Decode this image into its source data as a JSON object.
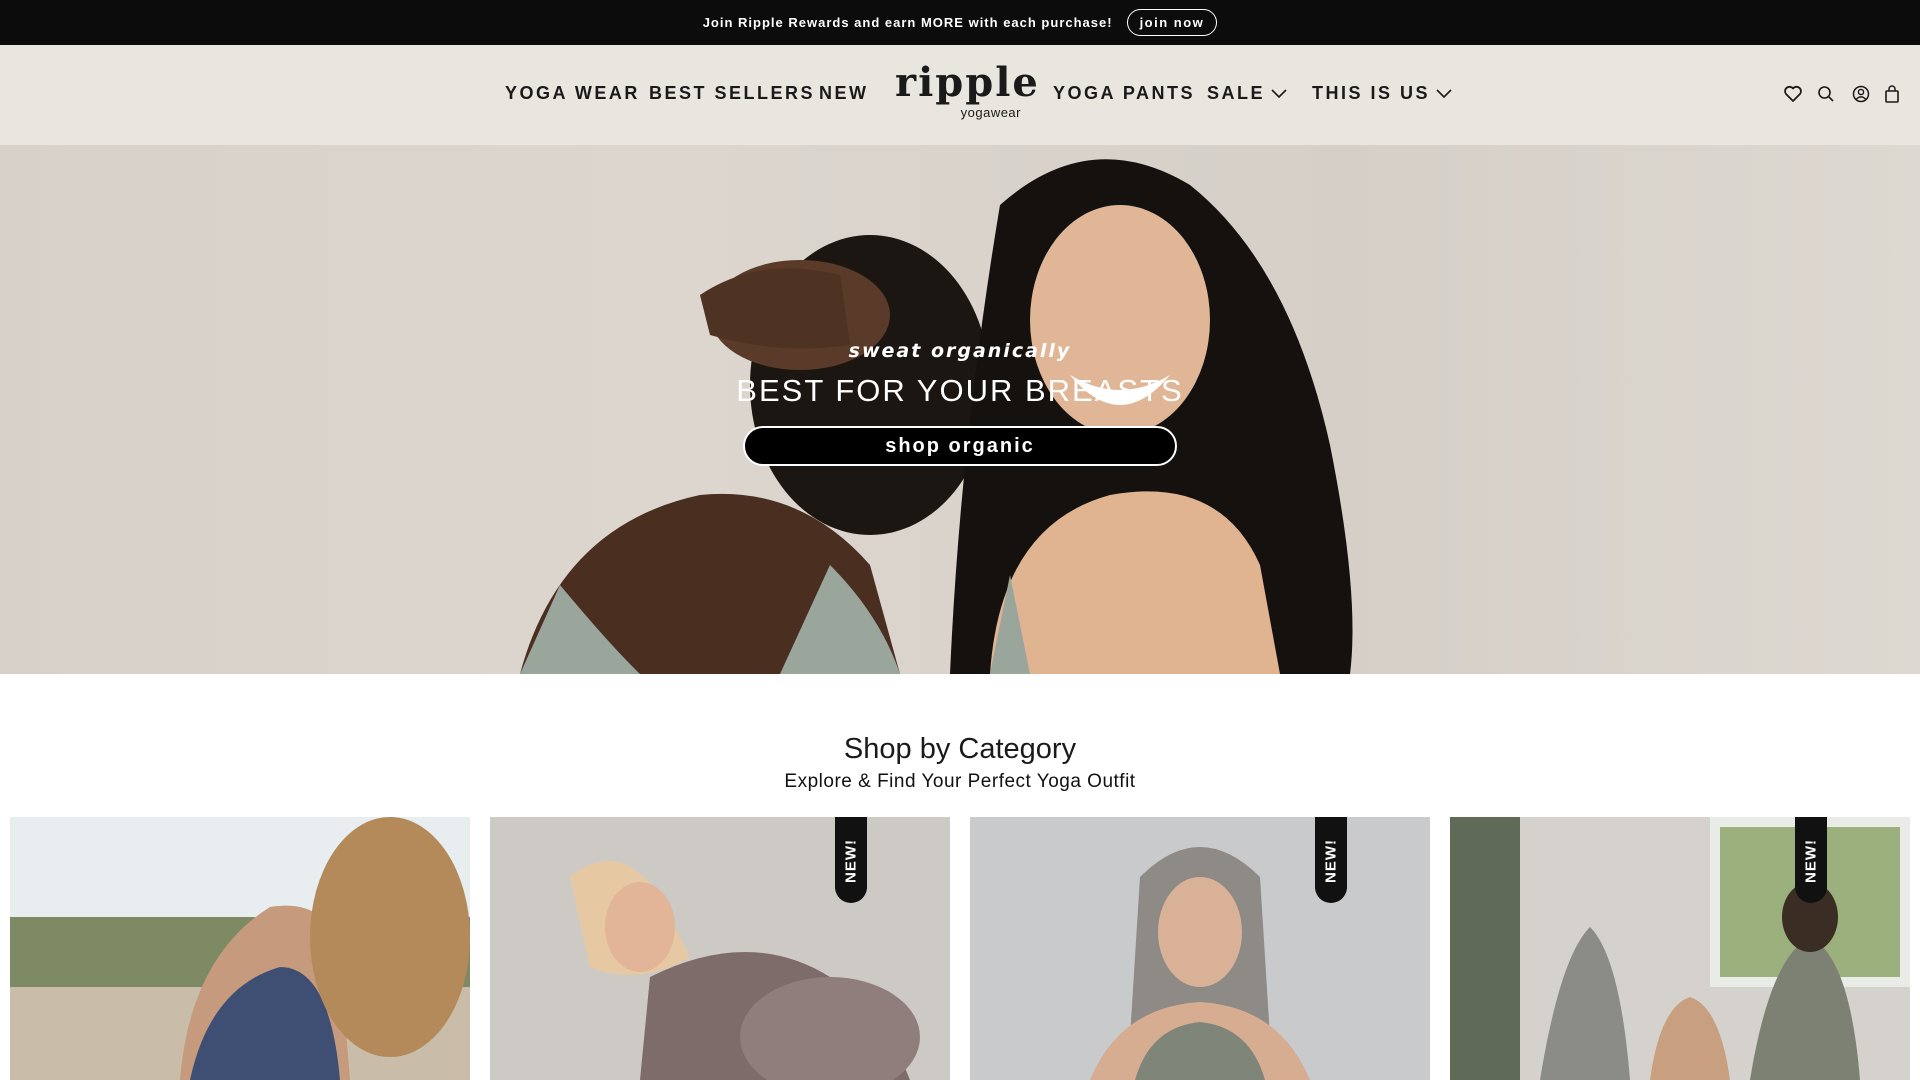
{
  "announcement": {
    "text": "Join Ripple Rewards and earn MORE with each purchase!",
    "button": "join now"
  },
  "header": {
    "nav_left": [
      "YOGA WEAR",
      "BEST SELLERS",
      "NEW"
    ],
    "logo_main": "ripple",
    "logo_sub": "yogawear",
    "nav_right": [
      "YOGA PANTS",
      "SALE",
      "THIS IS US"
    ],
    "icons": [
      "heart-icon",
      "search-icon",
      "account-icon",
      "bag-icon"
    ]
  },
  "hero": {
    "tagline": "sweat organically",
    "title": "BEST FOR YOUR BREASTS",
    "button": "shop organic"
  },
  "category": {
    "title": "Shop by Category",
    "subtitle": "Explore & Find Your Perfect Yoga Outfit",
    "badge": "NEW!"
  },
  "colors": {
    "announce_bg": "#0c0c0c",
    "header_bg": "#e9e6df",
    "hero_bg": "#d8d1c9"
  }
}
